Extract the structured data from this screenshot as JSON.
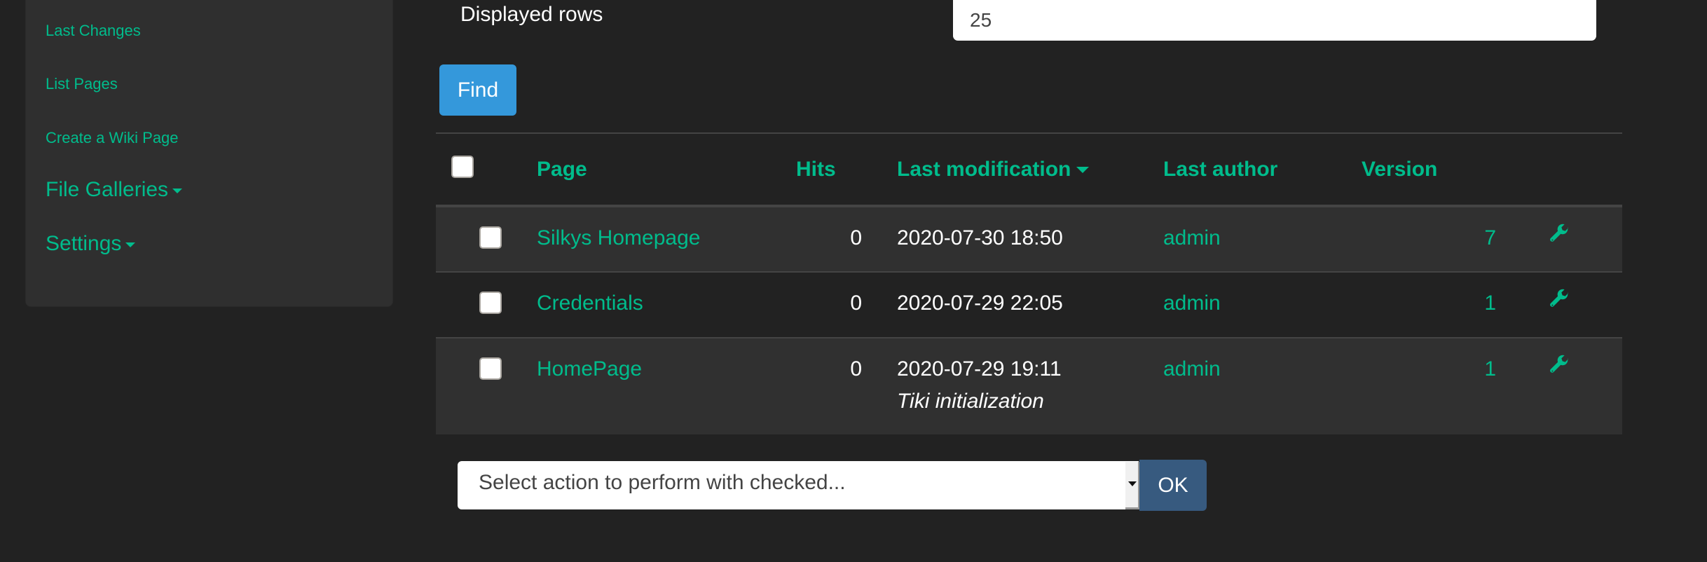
{
  "sidebar": {
    "items": [
      {
        "label": "Last Changes"
      },
      {
        "label": "List Pages"
      },
      {
        "label": "Create a Wiki Page"
      },
      {
        "label": "File Galleries",
        "has_dropdown": true
      },
      {
        "label": "Settings",
        "has_dropdown": true
      }
    ]
  },
  "filter": {
    "displayed_rows_label": "Displayed rows",
    "displayed_rows_value": "25",
    "find_label": "Find"
  },
  "table": {
    "columns": {
      "page": "Page",
      "hits": "Hits",
      "last_modification": "Last modification",
      "last_author": "Last author",
      "version": "Version"
    },
    "sort": {
      "column": "last_modification",
      "direction": "desc"
    },
    "rows": [
      {
        "page": "Silkys Homepage",
        "hits": "0",
        "last_modification": "2020-07-30 18:50",
        "comment": "",
        "last_author": "admin",
        "version": "7",
        "action_icon": "wrench-icon"
      },
      {
        "page": "Credentials",
        "hits": "0",
        "last_modification": "2020-07-29 22:05",
        "comment": "",
        "last_author": "admin",
        "version": "1",
        "action_icon": "wrench-icon"
      },
      {
        "page": "HomePage",
        "hits": "0",
        "last_modification": "2020-07-29 19:11",
        "comment": "Tiki initialization",
        "last_author": "admin",
        "version": "1",
        "action_icon": "wrench-icon"
      }
    ]
  },
  "bulk_action": {
    "select_value": "Select action to perform with checked...",
    "ok_label": "OK"
  },
  "colors": {
    "accent": "#00bc8c",
    "background": "#222222",
    "panel": "#2f2f2f",
    "primary_button": "#3498db",
    "ok_button": "#375a7f"
  }
}
